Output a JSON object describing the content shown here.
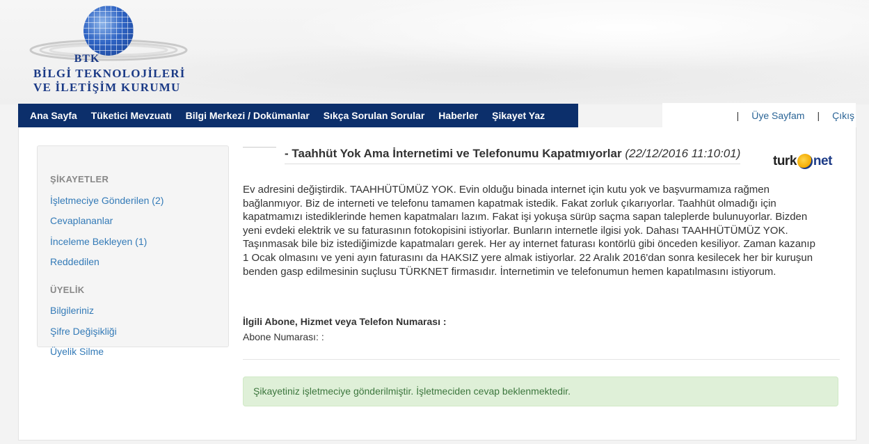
{
  "logo": {
    "abbr": "BTK",
    "line1": "BİLGİ TEKNOLOJİLERİ",
    "line2": "VE İLETİŞİM KURUMU"
  },
  "nav": {
    "items": [
      {
        "label": "Ana Sayfa"
      },
      {
        "label": "Tüketici Mevzuatı"
      },
      {
        "label": "Bilgi Merkezi / Dokümanlar"
      },
      {
        "label": "Sıkça Sorulan Sorular"
      },
      {
        "label": "Haberler"
      },
      {
        "label": "Şikayet Yaz"
      }
    ]
  },
  "topright": {
    "separator": "|",
    "member_page": "Üye Sayfam",
    "logout": "Çıkış"
  },
  "sidebar": {
    "complaints_header": "ŞİKAYETLER",
    "complaints": [
      {
        "label": "İşletmeciye Gönderilen (2)"
      },
      {
        "label": "Cevaplananlar"
      },
      {
        "label": "İnceleme Bekleyen (1)"
      },
      {
        "label": "Reddedilen"
      }
    ],
    "membership_header": "ÜYELİK",
    "membership": [
      {
        "label": "Bilgileriniz"
      },
      {
        "label": "Şifre Değişikliği"
      },
      {
        "label": "Üyelik Silme"
      }
    ]
  },
  "complaint": {
    "title": "- Taahhüt Yok Ama İnternetimi ve Telefonumu Kapatmıyorlar",
    "date": "(22/12/2016 11:10:01)",
    "brand_left": "turk",
    "brand_right": "net",
    "body": "Ev adresini değiştirdik. TAAHHÜTÜMÜZ YOK. Evin olduğu binada internet için kutu yok ve başvurmamıza rağmen bağlanmıyor. Biz de interneti ve telefonu tamamen kapatmak istedik. Fakat zorluk çıkarıyorlar. Taahhüt olmadığı için kapatmamızı istediklerinde hemen kapatmaları lazım. Fakat işi yokuşa sürüp saçma sapan taleplerde bulunuyorlar. Bizden yeni evdeki elektrik ve su faturasının fotokopisini istiyorlar. Bunların internetle ilgisi yok. Dahası TAAHHÜTÜMÜZ YOK. Taşınmasak bile biz istediğimizde kapatmaları gerek. Her ay internet faturası kontörlü gibi önceden kesiliyor. Zaman kazanıp 1 Ocak olmasını ve yeni ayın faturasını da HAKSIZ yere almak istiyorlar. 22 Aralık 2016'dan sonra kesilecek her bir kuruşun benden gasp edilmesinin suçlusu TÜRKNET firmasıdır. İnternetimin ve telefonumun hemen kapatılmasını istiyorum.",
    "related_header": "İlgili Abone, Hizmet veya Telefon Numarası :",
    "subscriber_label": "Abone Numarası: :"
  },
  "status_message": "Şikayetiniz işletmeciye gönderilmiştir. İşletmeciden cevap beklenmektedir."
}
